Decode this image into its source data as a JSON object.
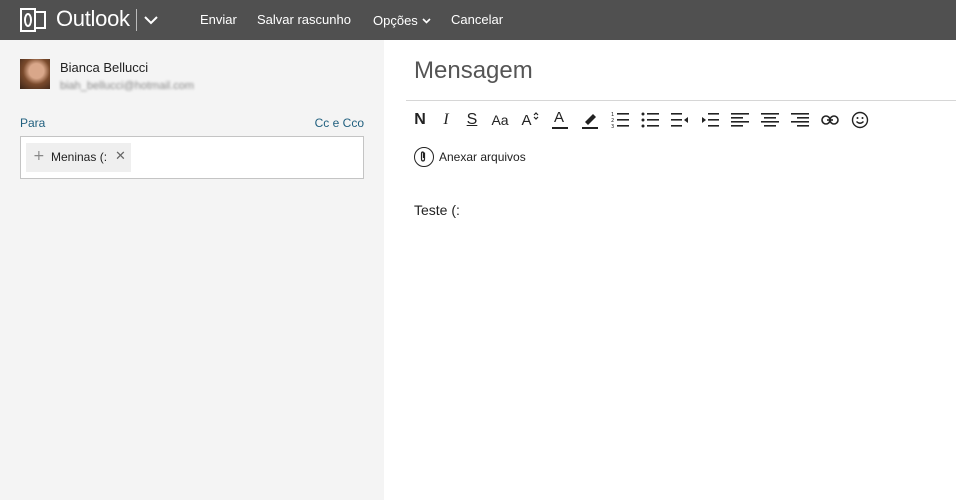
{
  "topbar": {
    "brand": "Outlook",
    "nav": {
      "send": "Enviar",
      "save_draft": "Salvar rascunho",
      "options": "Opções",
      "cancel": "Cancelar"
    },
    "logo_letter": "O"
  },
  "sender": {
    "name": "Bianca Bellucci",
    "email": "biah_bellucci@hotmail.com"
  },
  "recipients": {
    "to_label": "Para",
    "cc_bcc_label": "Cc e Cco",
    "chips": [
      {
        "label": "Meninas (:"
      }
    ]
  },
  "message": {
    "subject_placeholder": "Mensagem",
    "attach_label": "Anexar arquivos",
    "body": "Teste (:"
  },
  "toolbar": {
    "bold": "N",
    "italic": "I",
    "strike": "S",
    "font_size": "Aa",
    "grow_font": "A",
    "font_color": "A"
  },
  "colors": {
    "topbar": "#505050",
    "left_pane": "#f4f4f4",
    "link": "#21607f"
  }
}
